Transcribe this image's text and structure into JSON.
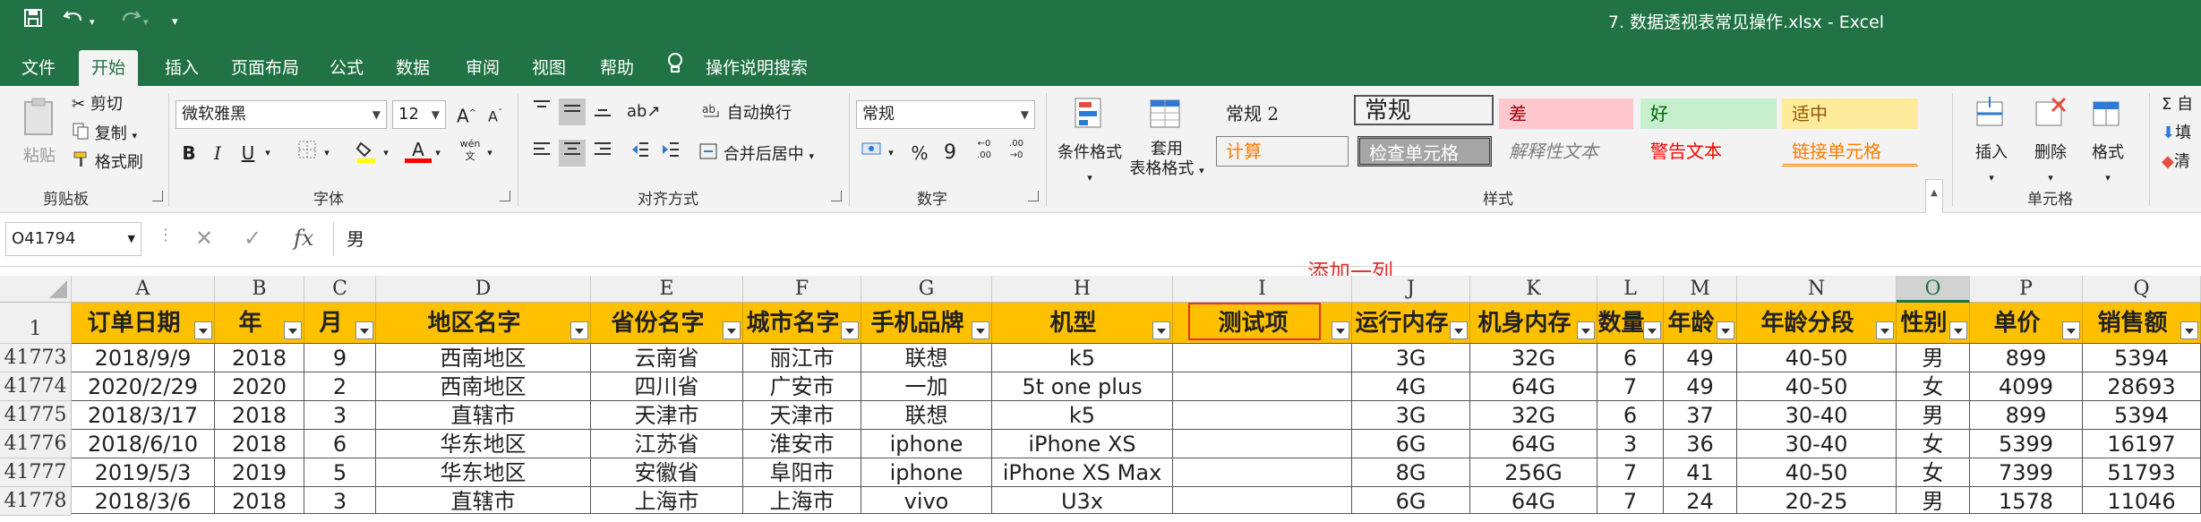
{
  "window": {
    "title": "7. 数据透视表常见操作.xlsx  -  Excel"
  },
  "quick_access": {
    "icons": [
      "save-icon",
      "undo-icon",
      "redo-icon",
      "customize-icon"
    ]
  },
  "menu": {
    "tabs": [
      "文件",
      "开始",
      "插入",
      "页面布局",
      "公式",
      "数据",
      "审阅",
      "视图",
      "帮助"
    ],
    "active": "开始",
    "tell_me": "操作说明搜索"
  },
  "ribbon": {
    "clipboard": {
      "label": "剪贴板",
      "paste": "粘贴",
      "cut": "剪切",
      "copy": "复制",
      "format_painter": "格式刷"
    },
    "font": {
      "label": "字体",
      "font_name": "微软雅黑",
      "font_size": "12",
      "bold": "B",
      "italic": "I",
      "underline": "U",
      "wen": "wén"
    },
    "alignment": {
      "label": "对齐方式",
      "wrap": "自动换行",
      "merge": "合并后居中"
    },
    "number": {
      "label": "数字",
      "format": "常规",
      "percent": "%",
      "comma": "9"
    },
    "styles": {
      "label": "样式",
      "conditional": "条件格式",
      "table_format_1": "套用",
      "table_format_2": "表格格式",
      "cells": [
        {
          "text": "常规 2",
          "color": "#222222",
          "bg": "#ffffff"
        },
        {
          "text": "常规",
          "color": "#222222",
          "bg": "#ffffff"
        },
        {
          "text": "差",
          "color": "#9c0006",
          "bg": "#ffc7ce"
        },
        {
          "text": "好",
          "color": "#006100",
          "bg": "#c6efce"
        },
        {
          "text": "适中",
          "color": "#9c5700",
          "bg": "#ffeb9c"
        },
        {
          "text": "计算",
          "color": "#fa7d00",
          "bg": "#f2f2f2"
        },
        {
          "text": "检查单元格",
          "color": "#ffffff",
          "bg": "#a5a5a5"
        },
        {
          "text": "解释性文本",
          "color": "#7f7f7f",
          "bg": "#ffffff"
        },
        {
          "text": "警告文本",
          "color": "#ff0000",
          "bg": "#ffffff"
        },
        {
          "text": "链接单元格",
          "color": "#fa7d00",
          "bg": "#ffffff"
        }
      ]
    },
    "cells": {
      "label": "单元格",
      "insert": "插入",
      "delete": "删除",
      "format": "格式"
    },
    "editing": {
      "sum": "Σ 自",
      "fill": "填",
      "clear": "清"
    }
  },
  "formula_bar": {
    "name_box": "O41794",
    "cancel": "✕",
    "enter": "✓",
    "fx": "fx",
    "content": "男"
  },
  "annotation": "添加一列",
  "sheet": {
    "columns": [
      "A",
      "B",
      "C",
      "D",
      "E",
      "F",
      "G",
      "H",
      "I",
      "J",
      "K",
      "L",
      "M",
      "N",
      "O",
      "P",
      "Q"
    ],
    "selected_column": "O",
    "header_row_number": "1",
    "headers": [
      "订单日期",
      "年",
      "月",
      "地区名字",
      "省份名字",
      "城市名字",
      "手机品牌",
      "机型",
      "测试项",
      "运行内存",
      "机身内存",
      "数量",
      "年龄",
      "年龄分段",
      "性别",
      "单价",
      "销售额"
    ],
    "rows": [
      {
        "num": "41773",
        "cells": [
          "2018/9/9",
          "2018",
          "9",
          "西南地区",
          "云南省",
          "丽江市",
          "联想",
          "k5",
          "",
          "3G",
          "32G",
          "6",
          "49",
          "40-50",
          "男",
          "899",
          "5394"
        ]
      },
      {
        "num": "41774",
        "cells": [
          "2020/2/29",
          "2020",
          "2",
          "西南地区",
          "四川省",
          "广安市",
          "一加",
          "5t one plus",
          "",
          "4G",
          "64G",
          "7",
          "49",
          "40-50",
          "女",
          "4099",
          "28693"
        ]
      },
      {
        "num": "41775",
        "cells": [
          "2018/3/17",
          "2018",
          "3",
          "直辖市",
          "天津市",
          "天津市",
          "联想",
          "k5",
          "",
          "3G",
          "32G",
          "6",
          "37",
          "30-40",
          "男",
          "899",
          "5394"
        ]
      },
      {
        "num": "41776",
        "cells": [
          "2018/6/10",
          "2018",
          "6",
          "华东地区",
          "江苏省",
          "淮安市",
          "iphone",
          "iPhone XS",
          "",
          "6G",
          "64G",
          "3",
          "36",
          "30-40",
          "女",
          "5399",
          "16197"
        ]
      },
      {
        "num": "41777",
        "cells": [
          "2019/5/3",
          "2019",
          "5",
          "华东地区",
          "安徽省",
          "阜阳市",
          "iphone",
          "iPhone XS Max",
          "",
          "8G",
          "256G",
          "7",
          "41",
          "40-50",
          "女",
          "7399",
          "51793"
        ]
      },
      {
        "num": "41778",
        "cells": [
          "2018/3/6",
          "2018",
          "3",
          "直辖市",
          "上海市",
          "上海市",
          "vivo",
          "U3x",
          "",
          "6G",
          "64G",
          "7",
          "24",
          "20-25",
          "男",
          "1578",
          "11046"
        ]
      }
    ]
  }
}
